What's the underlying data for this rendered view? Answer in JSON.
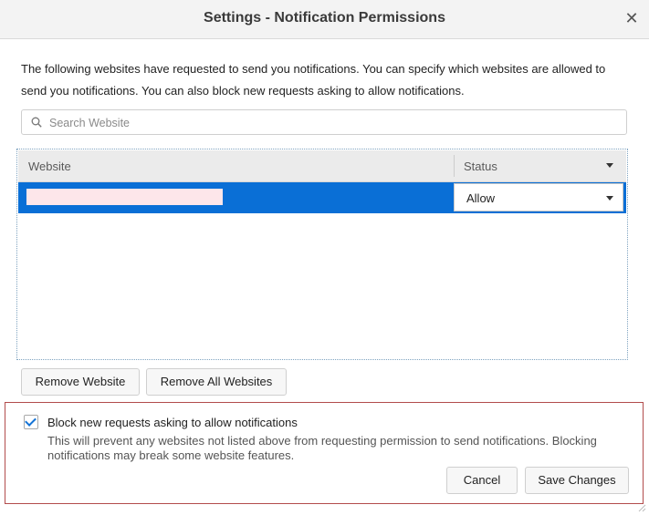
{
  "dialog": {
    "title": "Settings - Notification Permissions",
    "close_icon": "close-icon"
  },
  "description": "The following websites have requested to send you notifications. You can specify which websites are allowed to send you notifications. You can also block new requests asking to allow notifications.",
  "search": {
    "placeholder": "Search Website",
    "value": "",
    "icon": "search-icon"
  },
  "table": {
    "columns": [
      "Website",
      "Status"
    ],
    "rows": [
      {
        "website": "",
        "status": "Allow"
      }
    ]
  },
  "buttons": {
    "remove_website": "Remove Website",
    "remove_all": "Remove All Websites",
    "cancel": "Cancel",
    "save": "Save Changes"
  },
  "block": {
    "checked": true,
    "label": "Block new requests asking to allow notifications",
    "description": "This will prevent any websites not listed above from requesting permission to send notifications. Blocking notifications may break some website features."
  },
  "colors": {
    "selection": "#0a6fd6",
    "highlight_border": "#b24c4c"
  }
}
